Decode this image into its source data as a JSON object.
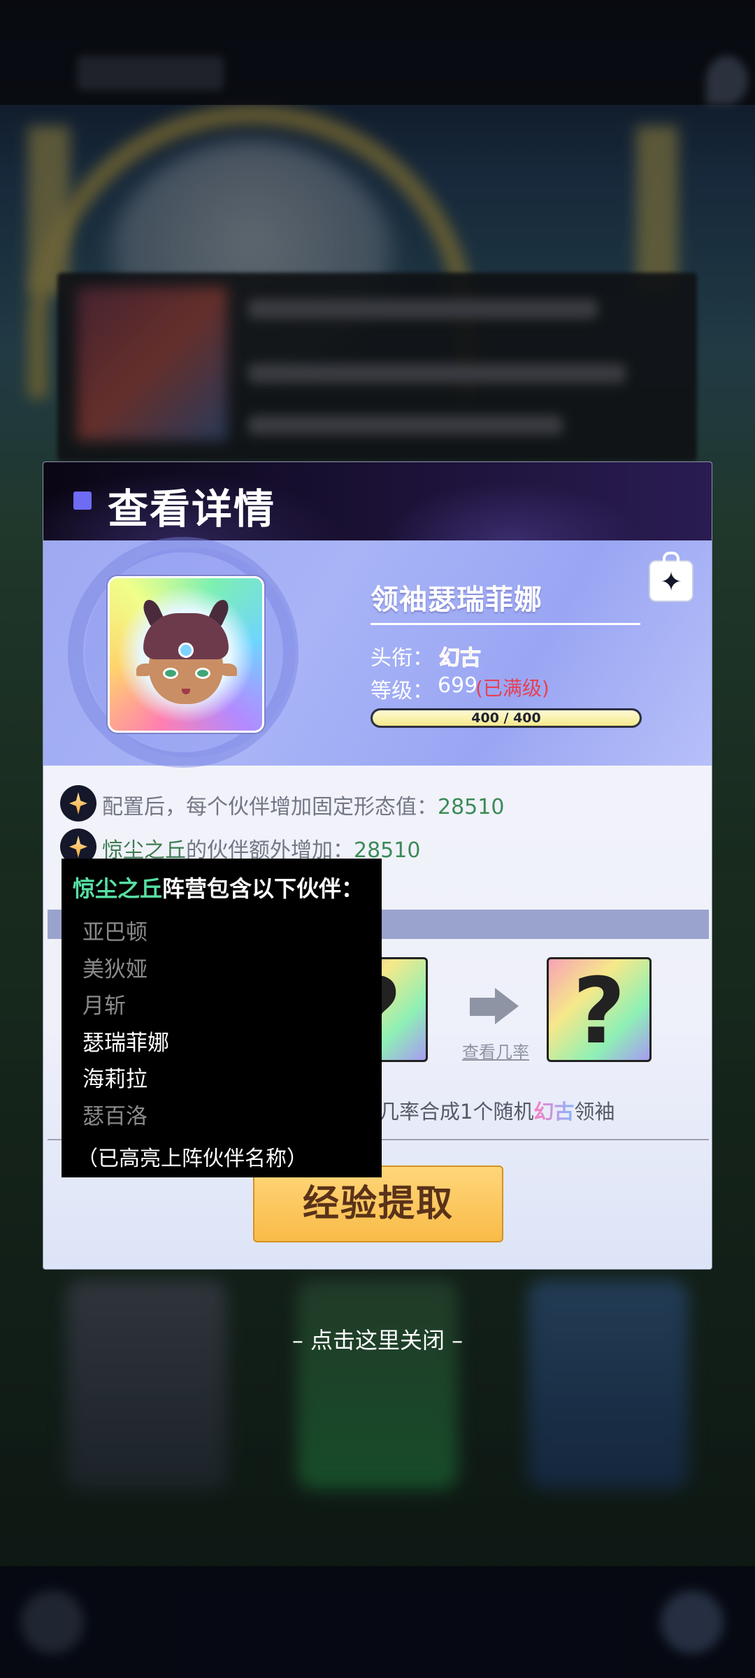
{
  "modal": {
    "title": "查看详情",
    "hero": {
      "name": "领袖瑟瑞菲娜",
      "title_label": "头衔：",
      "title_value": "幻古",
      "level_label": "等级：",
      "level_value": "699",
      "level_status": "(已满级)",
      "xp_text": "400 / 400",
      "xp_fraction": 1.0
    },
    "info": {
      "line1": {
        "text": "配置后，每个伙伴增加固定形态值：",
        "value": "28510"
      },
      "line2": {
        "link": "惊尘之丘",
        "text": "的伙伴额外增加：",
        "value": "28510"
      }
    },
    "synth": {
      "prob_link": "查看几率",
      "text_prefix": "几率合成1个随机",
      "badge": "幻古",
      "text_suffix": "领袖",
      "card_glyph": "?"
    },
    "extract_button": "经验提取"
  },
  "tooltip": {
    "faction": "惊尘之丘",
    "title_suffix": "阵营包含以下伙伴：",
    "members": [
      {
        "name": "亚巴顿",
        "on_team": false
      },
      {
        "name": "美狄娅",
        "on_team": false
      },
      {
        "name": "月斩",
        "on_team": false
      },
      {
        "name": "瑟瑞菲娜",
        "on_team": true
      },
      {
        "name": "海莉拉",
        "on_team": true
      },
      {
        "name": "瑟百洛",
        "on_team": false
      }
    ],
    "note": "（已高亮上阵伙伴名称）"
  },
  "close_hint": "– 点击这里关闭 –",
  "colors": {
    "accent_square": "#6e6cf5",
    "value_green": "#3c8a57",
    "faction_green": "#57e0a4",
    "maxed_red": "#e83f55",
    "button_gold": "#f9bb48"
  },
  "icons": [
    "star-gem-icon",
    "share-lock-icon",
    "arrow-right-icon",
    "question-card-icon"
  ]
}
